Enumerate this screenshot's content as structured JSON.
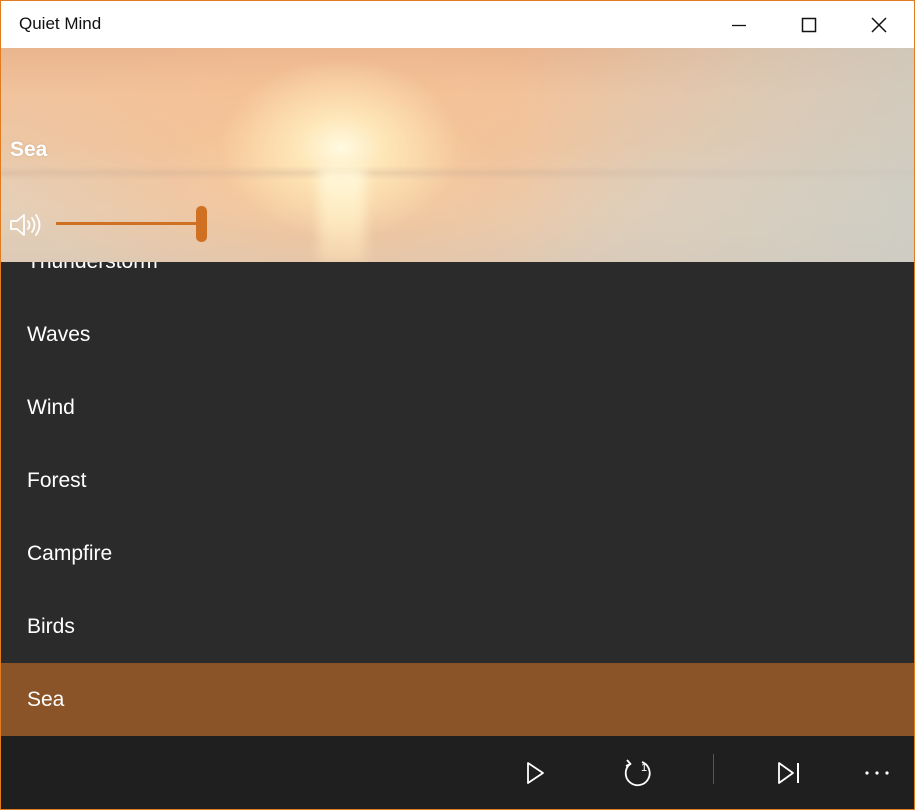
{
  "window": {
    "title": "Quiet Mind",
    "accent_color": "#e07b1f",
    "controls": [
      {
        "name": "minimize-icon"
      },
      {
        "name": "maximize-icon"
      },
      {
        "name": "close-icon"
      }
    ]
  },
  "header": {
    "now_playing": "Sea",
    "background_image": "sunset-over-sea",
    "volume_icon": "speaker-volume-icon",
    "volume_level": 1.0,
    "slider_color": "#d07022"
  },
  "sounds": {
    "items": [
      {
        "label": "Thunderstorm",
        "selected": false
      },
      {
        "label": "Waves",
        "selected": false
      },
      {
        "label": "Wind",
        "selected": false
      },
      {
        "label": "Forest",
        "selected": false
      },
      {
        "label": "Campfire",
        "selected": false
      },
      {
        "label": "Birds",
        "selected": false
      },
      {
        "label": "Sea",
        "selected": true
      }
    ],
    "selected_color": "#8a5428",
    "background_color": "#2b2b2b"
  },
  "command_bar": {
    "buttons": [
      {
        "name": "play-icon"
      },
      {
        "name": "repeat-one-icon",
        "badge": "1"
      },
      {
        "name": "skip-next-icon"
      },
      {
        "name": "more-icon"
      }
    ]
  }
}
